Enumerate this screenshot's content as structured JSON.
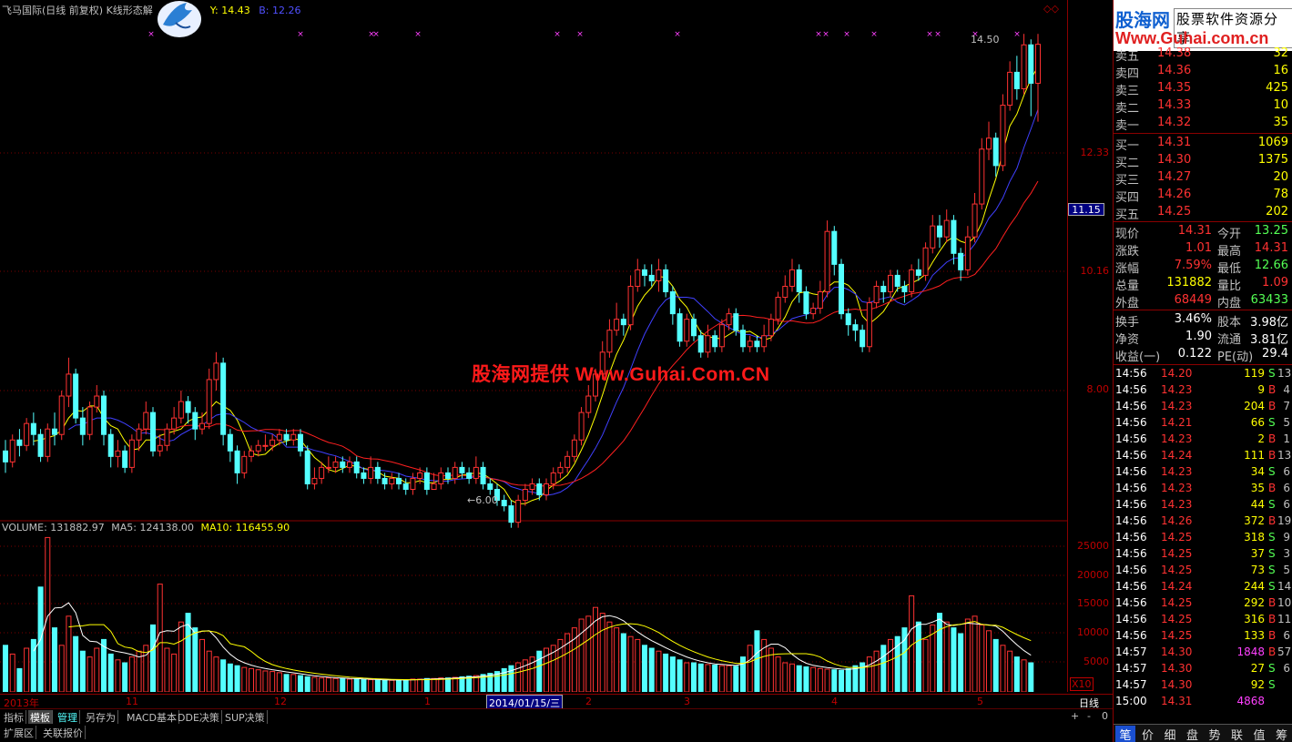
{
  "top": {
    "title": "飞马国际(日线 前复权) K线形态解",
    "y_label": "Y: 14.43",
    "b_label": "B: 12.26"
  },
  "chart_data": {
    "type": "candlestick",
    "price_axis": [
      "12.33",
      "10.16",
      "8.00"
    ],
    "price_markers": [
      "14.50",
      "6.00"
    ],
    "current_price_box": "11.15",
    "candles": [
      [
        6.9,
        6.7,
        7.1,
        6.5
      ],
      [
        6.7,
        7.1,
        7.2,
        6.6
      ],
      [
        7.1,
        7.0,
        7.3,
        6.8
      ],
      [
        7.0,
        7.4,
        7.5,
        6.9
      ],
      [
        7.4,
        7.2,
        7.6,
        7.0
      ],
      [
        7.2,
        6.8,
        7.3,
        6.7
      ],
      [
        6.8,
        7.3,
        7.4,
        6.7
      ],
      [
        7.3,
        7.2,
        7.6,
        7.0
      ],
      [
        7.2,
        7.9,
        8.0,
        7.1
      ],
      [
        7.9,
        8.3,
        8.6,
        7.7
      ],
      [
        8.3,
        7.5,
        8.4,
        7.4
      ],
      [
        7.5,
        7.2,
        7.7,
        7.0
      ],
      [
        7.2,
        7.7,
        7.8,
        7.1
      ],
      [
        7.7,
        7.9,
        8.1,
        7.6
      ],
      [
        7.9,
        7.2,
        8.0,
        7.0
      ],
      [
        7.2,
        6.8,
        7.3,
        6.6
      ],
      [
        6.8,
        6.9,
        7.1,
        6.6
      ],
      [
        6.9,
        6.6,
        7.0,
        6.5
      ],
      [
        6.6,
        7.1,
        7.2,
        6.5
      ],
      [
        7.1,
        7.3,
        7.4,
        6.9
      ],
      [
        7.3,
        7.6,
        7.8,
        7.2
      ],
      [
        7.6,
        6.9,
        7.7,
        6.8
      ],
      [
        6.9,
        7.0,
        7.2,
        6.8
      ],
      [
        7.0,
        7.3,
        7.4,
        6.9
      ],
      [
        7.3,
        7.5,
        7.7,
        7.2
      ],
      [
        7.5,
        7.8,
        8.0,
        7.4
      ],
      [
        7.8,
        7.6,
        7.9,
        7.4
      ],
      [
        7.6,
        7.3,
        7.7,
        7.1
      ],
      [
        7.3,
        7.4,
        7.6,
        7.2
      ],
      [
        7.4,
        8.2,
        8.4,
        7.3
      ],
      [
        8.2,
        8.5,
        8.7,
        8.0
      ],
      [
        8.5,
        7.2,
        8.6,
        7.0
      ],
      [
        7.2,
        6.9,
        7.3,
        6.7
      ],
      [
        6.9,
        6.5,
        7.0,
        6.3
      ],
      [
        6.5,
        6.8,
        6.9,
        6.4
      ],
      [
        6.8,
        6.9,
        7.0,
        6.7
      ],
      [
        6.9,
        7.0,
        7.1,
        6.8
      ],
      [
        7.0,
        7.0,
        7.2,
        6.9
      ],
      [
        7.0,
        7.1,
        7.2,
        6.9
      ],
      [
        7.1,
        7.2,
        7.3,
        7.0
      ],
      [
        7.2,
        7.1,
        7.3,
        7.0
      ],
      [
        7.1,
        7.2,
        7.3,
        7.0
      ],
      [
        7.2,
        6.9,
        7.3,
        6.8
      ],
      [
        6.9,
        6.3,
        7.0,
        6.2
      ],
      [
        6.3,
        6.4,
        6.6,
        6.2
      ],
      [
        6.4,
        6.6,
        6.7,
        6.3
      ],
      [
        6.6,
        6.6,
        6.8,
        6.5
      ],
      [
        6.6,
        6.7,
        6.8,
        6.5
      ],
      [
        6.7,
        6.6,
        6.8,
        6.5
      ],
      [
        6.6,
        6.7,
        6.8,
        6.5
      ],
      [
        6.7,
        6.5,
        6.8,
        6.4
      ],
      [
        6.5,
        6.4,
        6.6,
        6.3
      ],
      [
        6.4,
        6.6,
        6.8,
        6.3
      ],
      [
        6.6,
        6.4,
        6.7,
        6.3
      ],
      [
        6.4,
        6.3,
        6.5,
        6.2
      ],
      [
        6.3,
        6.4,
        6.5,
        6.2
      ],
      [
        6.4,
        6.3,
        6.5,
        6.2
      ],
      [
        6.3,
        6.2,
        6.4,
        6.1
      ],
      [
        6.2,
        6.4,
        6.5,
        6.1
      ],
      [
        6.4,
        6.5,
        6.6,
        6.3
      ],
      [
        6.5,
        6.2,
        6.6,
        6.1
      ],
      [
        6.2,
        6.3,
        6.5,
        6.2
      ],
      [
        6.3,
        6.5,
        6.6,
        6.2
      ],
      [
        6.5,
        6.4,
        6.6,
        6.3
      ],
      [
        6.4,
        6.6,
        6.7,
        6.3
      ],
      [
        6.6,
        6.5,
        6.7,
        6.4
      ],
      [
        6.5,
        6.4,
        6.6,
        6.3
      ],
      [
        6.4,
        6.6,
        6.8,
        6.3
      ],
      [
        6.6,
        6.3,
        6.7,
        6.2
      ],
      [
        6.3,
        6.2,
        6.4,
        6.1
      ],
      [
        6.2,
        6.0,
        6.3,
        5.9
      ],
      [
        6.0,
        5.9,
        6.1,
        5.8
      ],
      [
        5.9,
        5.6,
        6.0,
        5.5
      ],
      [
        5.6,
        6.0,
        6.1,
        5.5
      ],
      [
        6.0,
        6.2,
        6.3,
        5.9
      ],
      [
        6.2,
        6.3,
        6.4,
        6.1
      ],
      [
        6.3,
        6.1,
        6.4,
        6.0
      ],
      [
        6.1,
        6.3,
        6.4,
        6.0
      ],
      [
        6.3,
        6.5,
        6.6,
        6.2
      ],
      [
        6.5,
        6.6,
        6.7,
        6.4
      ],
      [
        6.6,
        6.8,
        6.9,
        6.5
      ],
      [
        6.8,
        7.1,
        7.2,
        6.7
      ],
      [
        7.1,
        7.6,
        7.7,
        7.0
      ],
      [
        7.6,
        7.9,
        8.1,
        7.5
      ],
      [
        7.9,
        8.3,
        8.4,
        7.8
      ],
      [
        8.3,
        8.7,
        8.9,
        8.2
      ],
      [
        8.7,
        9.1,
        9.3,
        8.6
      ],
      [
        9.1,
        9.3,
        9.6,
        9.0
      ],
      [
        9.3,
        9.2,
        9.4,
        9.0
      ],
      [
        9.2,
        9.9,
        10.1,
        9.1
      ],
      [
        9.9,
        10.2,
        10.4,
        9.8
      ],
      [
        10.2,
        10.1,
        10.3,
        9.9
      ],
      [
        10.1,
        10.0,
        10.3,
        9.9
      ],
      [
        10.0,
        10.2,
        10.4,
        9.8
      ],
      [
        10.2,
        9.8,
        10.3,
        9.7
      ],
      [
        9.8,
        9.4,
        9.9,
        9.2
      ],
      [
        9.4,
        8.9,
        9.5,
        8.8
      ],
      [
        8.9,
        9.3,
        9.4,
        8.8
      ],
      [
        9.3,
        9.0,
        9.4,
        8.9
      ],
      [
        9.0,
        8.7,
        9.1,
        8.6
      ],
      [
        8.7,
        9.0,
        9.2,
        8.6
      ],
      [
        9.0,
        8.8,
        9.1,
        8.7
      ],
      [
        8.8,
        9.2,
        9.3,
        8.7
      ],
      [
        9.2,
        9.4,
        9.5,
        9.1
      ],
      [
        9.4,
        9.1,
        9.5,
        9.0
      ],
      [
        9.1,
        8.8,
        9.2,
        8.7
      ],
      [
        8.8,
        8.9,
        9.0,
        8.7
      ],
      [
        8.9,
        8.8,
        9.0,
        8.7
      ],
      [
        8.8,
        9.0,
        9.2,
        8.7
      ],
      [
        9.0,
        9.3,
        9.4,
        8.9
      ],
      [
        9.3,
        9.7,
        9.8,
        9.2
      ],
      [
        9.7,
        9.9,
        10.1,
        9.6
      ],
      [
        9.9,
        10.2,
        10.4,
        9.8
      ],
      [
        10.2,
        9.8,
        10.3,
        9.6
      ],
      [
        9.8,
        9.4,
        9.9,
        9.3
      ],
      [
        9.4,
        9.5,
        9.6,
        9.3
      ],
      [
        9.5,
        9.8,
        10.0,
        9.4
      ],
      [
        9.8,
        10.9,
        11.1,
        9.7
      ],
      [
        10.9,
        10.3,
        11.0,
        10.1
      ],
      [
        10.3,
        9.4,
        10.4,
        9.3
      ],
      [
        9.4,
        9.2,
        9.5,
        9.0
      ],
      [
        9.2,
        9.1,
        9.3,
        8.9
      ],
      [
        9.1,
        8.8,
        9.2,
        8.7
      ],
      [
        8.8,
        9.6,
        9.7,
        8.7
      ],
      [
        9.6,
        9.9,
        10.0,
        9.5
      ],
      [
        9.9,
        9.8,
        10.0,
        9.6
      ],
      [
        9.8,
        10.1,
        10.2,
        9.7
      ],
      [
        10.1,
        9.9,
        10.2,
        9.8
      ],
      [
        9.9,
        9.8,
        10.0,
        9.6
      ],
      [
        9.8,
        10.2,
        10.3,
        9.7
      ],
      [
        10.2,
        10.1,
        10.4,
        10.0
      ],
      [
        10.1,
        10.6,
        10.7,
        10.0
      ],
      [
        10.6,
        11.0,
        11.2,
        10.5
      ],
      [
        11.0,
        10.8,
        11.2,
        10.6
      ],
      [
        10.8,
        11.1,
        11.3,
        10.7
      ],
      [
        11.1,
        10.5,
        11.2,
        10.3
      ],
      [
        10.5,
        10.2,
        10.6,
        10.0
      ],
      [
        10.2,
        10.8,
        11.0,
        10.1
      ],
      [
        10.8,
        11.4,
        11.6,
        10.7
      ],
      [
        11.4,
        12.4,
        12.6,
        11.3
      ],
      [
        12.4,
        12.6,
        12.9,
        12.2
      ],
      [
        12.6,
        12.1,
        12.7,
        11.9
      ],
      [
        12.1,
        13.2,
        13.4,
        12.0
      ],
      [
        13.2,
        13.8,
        14.0,
        13.1
      ],
      [
        13.8,
        13.5,
        14.1,
        13.3
      ],
      [
        13.5,
        14.3,
        14.5,
        13.4
      ],
      [
        14.3,
        13.6,
        14.4,
        13.0
      ],
      [
        13.6,
        14.31,
        14.5,
        12.9
      ]
    ],
    "volume": [
      8000,
      6500,
      4000,
      7500,
      9000,
      18000,
      26500,
      11000,
      8000,
      13000,
      9500,
      7000,
      6000,
      7500,
      9000,
      6500,
      5500,
      5000,
      6000,
      7000,
      8000,
      11500,
      18500,
      7500,
      6500,
      12000,
      13500,
      11000,
      9000,
      7000,
      6000,
      5500,
      4800,
      4500,
      4200,
      4000,
      3800,
      3600,
      3500,
      3300,
      3000,
      3000,
      2800,
      2600,
      2500,
      2400,
      2400,
      2300,
      2300,
      2200,
      2200,
      2100,
      2100,
      2000,
      2000,
      2000,
      2100,
      2100,
      2200,
      2200,
      2300,
      2300,
      2400,
      2400,
      2500,
      2600,
      2700,
      2800,
      3000,
      3200,
      3500,
      4000,
      4500,
      5000,
      5500,
      6000,
      7000,
      7500,
      8000,
      9000,
      10000,
      11000,
      12500,
      13000,
      14500,
      13500,
      12000,
      11000,
      10000,
      9500,
      9000,
      8000,
      7500,
      7000,
      6500,
      6000,
      5500,
      5000,
      5000,
      4800,
      4700,
      4600,
      4500,
      4500,
      4400,
      6000,
      8000,
      10500,
      9000,
      7500,
      6000,
      5000,
      4800,
      4500,
      4300,
      4200,
      4000,
      3900,
      3800,
      3700,
      4000,
      4500,
      5000,
      6000,
      7000,
      8000,
      9000,
      9500,
      11000,
      16500,
      12000,
      9000,
      11500,
      13500,
      12000,
      11000,
      10000,
      12500,
      13000,
      11500,
      10500,
      9000,
      8000,
      7000,
      6000,
      5500,
      5000
    ],
    "volume_axis": [
      "25000",
      "20000",
      "15000",
      "10000",
      "5000"
    ],
    "volume_unit": "X10",
    "x_labels": [
      "2013年",
      "11",
      "12",
      "1",
      "2014/01/15/三",
      "2",
      "3",
      "4",
      "5"
    ],
    "period": "日线"
  },
  "volume_header": {
    "volume": "VOLUME: 131882.97",
    "ma5": "MA5: 124138.00",
    "ma10": "MA10: 116455.90"
  },
  "tabs": [
    "指标",
    "模板",
    "管理",
    "另存为",
    "MACD基本",
    "DDE决策",
    "SUP决策"
  ],
  "tabs2": [
    "扩展区",
    "关联报价"
  ],
  "scroll_buttons": [
    "+",
    "-",
    "0"
  ],
  "watermark": "股海网提供 Www.Guhai.Com.CN",
  "logo": {
    "brand": "股海网",
    "slogan": "股票软件资源分享",
    "url": "Www.Guhai.com.cn"
  },
  "order_book": {
    "asks": [
      [
        "卖五",
        "14.38",
        "32"
      ],
      [
        "卖四",
        "14.36",
        "16"
      ],
      [
        "卖三",
        "14.35",
        "425"
      ],
      [
        "卖二",
        "14.33",
        "10"
      ],
      [
        "卖一",
        "14.32",
        "35"
      ]
    ],
    "bids": [
      [
        "买一",
        "14.31",
        "1069"
      ],
      [
        "买二",
        "14.30",
        "1375"
      ],
      [
        "买三",
        "14.27",
        "20"
      ],
      [
        "买四",
        "14.26",
        "78"
      ],
      [
        "买五",
        "14.25",
        "202"
      ]
    ]
  },
  "quote": [
    [
      "现价",
      "14.31",
      "今开",
      "13.25"
    ],
    [
      "涨跌",
      "1.01",
      "最高",
      "14.31"
    ],
    [
      "涨幅",
      "7.59%",
      "最低",
      "12.66"
    ],
    [
      "总量",
      "131882",
      "量比",
      "1.09"
    ],
    [
      "外盘",
      "68449",
      "内盘",
      "63433"
    ]
  ],
  "fundamentals": [
    [
      "换手",
      "3.46%",
      "股本",
      "3.98亿"
    ],
    [
      "净资",
      "1.90",
      "流通",
      "3.81亿"
    ],
    [
      "收益(一)",
      "0.122",
      "PE(动)",
      "29.4"
    ]
  ],
  "ticks": [
    [
      "14:56",
      "14.20",
      "119",
      "S",
      "13"
    ],
    [
      "14:56",
      "14.23",
      "9",
      "B",
      "4"
    ],
    [
      "14:56",
      "14.23",
      "204",
      "B",
      "7"
    ],
    [
      "14:56",
      "14.21",
      "66",
      "S",
      "5"
    ],
    [
      "14:56",
      "14.23",
      "2",
      "B",
      "1"
    ],
    [
      "14:56",
      "14.24",
      "111",
      "B",
      "13"
    ],
    [
      "14:56",
      "14.23",
      "34",
      "S",
      "6"
    ],
    [
      "14:56",
      "14.23",
      "35",
      "B",
      "6"
    ],
    [
      "14:56",
      "14.23",
      "44",
      "S",
      "6"
    ],
    [
      "14:56",
      "14.26",
      "372",
      "B",
      "19"
    ],
    [
      "14:56",
      "14.25",
      "318",
      "S",
      "9"
    ],
    [
      "14:56",
      "14.25",
      "37",
      "S",
      "3"
    ],
    [
      "14:56",
      "14.25",
      "73",
      "S",
      "5"
    ],
    [
      "14:56",
      "14.24",
      "244",
      "S",
      "14"
    ],
    [
      "14:56",
      "14.25",
      "292",
      "B",
      "10"
    ],
    [
      "14:56",
      "14.25",
      "316",
      "B",
      "11"
    ],
    [
      "14:56",
      "14.25",
      "133",
      "B",
      "6"
    ],
    [
      "14:57",
      "14.30",
      "1848",
      "B",
      "57"
    ],
    [
      "14:57",
      "14.30",
      "27",
      "S",
      "6"
    ],
    [
      "14:57",
      "14.30",
      "92",
      "S",
      ""
    ],
    [
      "15:00",
      "14.31",
      "4868",
      "",
      ""
    ]
  ],
  "bottom_tabs": [
    "笔",
    "价",
    "细",
    "盘",
    "势",
    "联",
    "值",
    "筹"
  ],
  "colors": {
    "up": "#ff3232",
    "down": "#54ffff",
    "ma1": "#ffff00",
    "ma2": "#4040ff",
    "ma3": "#ff2020"
  }
}
